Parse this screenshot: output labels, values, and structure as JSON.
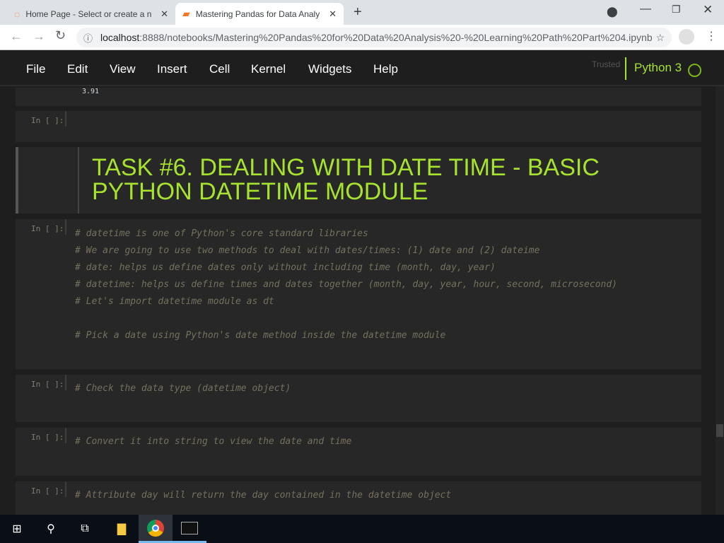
{
  "browser": {
    "tabs": [
      {
        "title": "Home Page - Select or create a n"
      },
      {
        "title": "Mastering Pandas for Data Analy"
      }
    ],
    "url_host": "localhost",
    "url_rest": ":8888/notebooks/Mastering%20Pandas%20for%20Data%20Analysis%20-%20Learning%20Path%20Part%204.ipynb"
  },
  "menu": [
    "File",
    "Edit",
    "View",
    "Insert",
    "Cell",
    "Kernel",
    "Widgets",
    "Help"
  ],
  "kernel": {
    "trusted": "Trusted",
    "name": "Python 3"
  },
  "output": "3.91",
  "prompt": "In [ ]:",
  "heading": [
    "TASK #6. DEALING WITH DATE TIME - BASIC",
    "PYTHON DATETIME MODULE"
  ],
  "cells": [
    "# datetime is one of Python's core standard libraries\n# We are going to use two methods to deal with dates/times: (1) date and (2) dateime\n# date: helps us define dates only without including time (month, day, year)\n# datetime: helps us define times and dates together (month, day, year, hour, second, microsecond)\n# Let's import datetime module as dt\n\n# Pick a date using Python's date method inside the datetime module",
    "# Check the data type (datetime object)",
    "# Convert it into string to view the date and time",
    "# Attribute day will return the day contained in the datetime object"
  ]
}
